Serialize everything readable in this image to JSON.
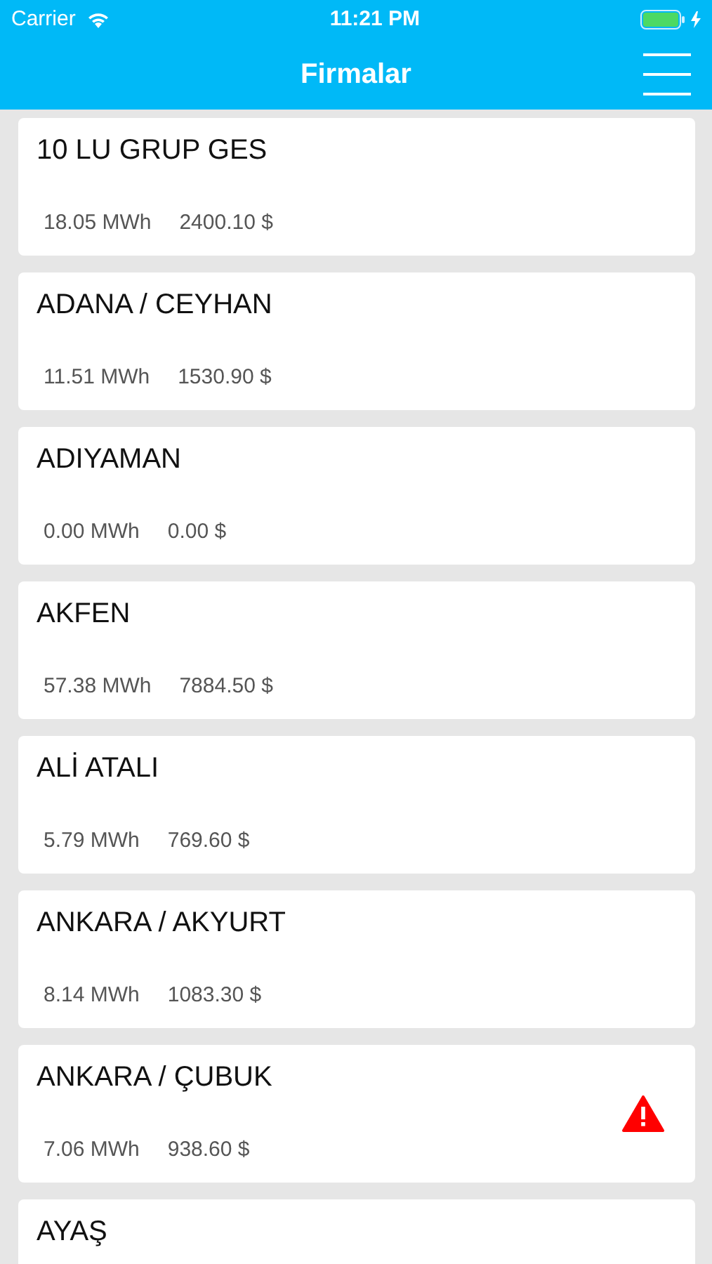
{
  "status_bar": {
    "carrier": "Carrier",
    "time": "11:21 PM",
    "battery_charging": true
  },
  "navbar": {
    "title": "Firmalar"
  },
  "companies": [
    {
      "name": "10 LU GRUP GES",
      "energy": "18.05 MWh",
      "amount": "2400.10 $",
      "warning": false
    },
    {
      "name": "ADANA / CEYHAN",
      "energy": "11.51 MWh",
      "amount": "1530.90 $",
      "warning": false
    },
    {
      "name": "ADIYAMAN",
      "energy": "0.00 MWh",
      "amount": "0.00 $",
      "warning": false
    },
    {
      "name": "AKFEN",
      "energy": "57.38 MWh",
      "amount": "7884.50 $",
      "warning": false
    },
    {
      "name": "ALİ ATALI",
      "energy": "5.79 MWh",
      "amount": "769.60 $",
      "warning": false
    },
    {
      "name": "ANKARA / AKYURT",
      "energy": "8.14 MWh",
      "amount": "1083.30 $",
      "warning": false
    },
    {
      "name": "ANKARA / ÇUBUK",
      "energy": "7.06 MWh",
      "amount": "938.60 $",
      "warning": true
    },
    {
      "name": "AYAŞ",
      "warning": false
    }
  ]
}
